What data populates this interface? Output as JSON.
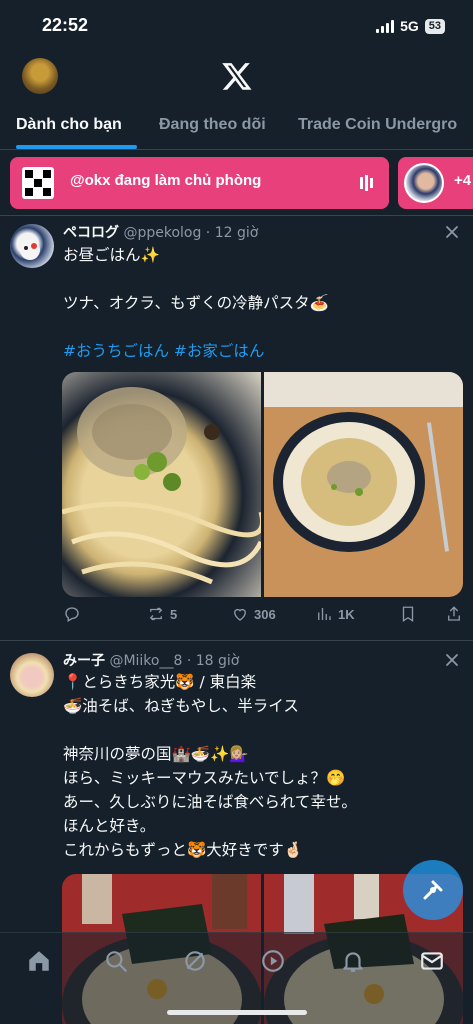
{
  "status": {
    "time": "22:52",
    "network": "5G",
    "battery": "53"
  },
  "colors": {
    "accent": "#1d9bf0",
    "space_pill": "#e8407a",
    "background": "#15202b"
  },
  "tabs": [
    {
      "label": "Dành cho bạn",
      "active": true
    },
    {
      "label": "Đang theo dõi",
      "active": false
    },
    {
      "label": "Trade Coin Undergro",
      "active": false
    }
  ],
  "spaces": {
    "host_text": "@okx đang làm chủ phòng",
    "more_text": "+4"
  },
  "posts": [
    {
      "name": "ペコログ",
      "handle": "@ppekolog",
      "time": " · 12 giờ",
      "body": "お昼ごはん✨\n\nツナ、オクラ、もずくの冷静パスタ🍝",
      "hashtags": "#おうちごはん #お家ごはん",
      "retweets": "5",
      "likes": "306",
      "views": "1K"
    },
    {
      "name": "みー子",
      "handle": "@Miiko__8",
      "time": " · 18 giờ",
      "body": "📍とらきち家光🐯 / 東白楽\n🍜油そば、ねぎもやし、半ライス\n\n神奈川の夢の国🏰🍜✨💁🏼‍♀️\nほら、ミッキーマウスみたいでしょ？🤭\nあー、久しぶりに油そば食べられて幸せ。\nほんと好き。\nこれからもずっと🐯大好きです🤞🏻"
    }
  ],
  "nav": {
    "items": [
      "home-icon",
      "search-icon",
      "grok-icon",
      "communities-icon",
      "notifications-icon",
      "messages-icon"
    ]
  }
}
